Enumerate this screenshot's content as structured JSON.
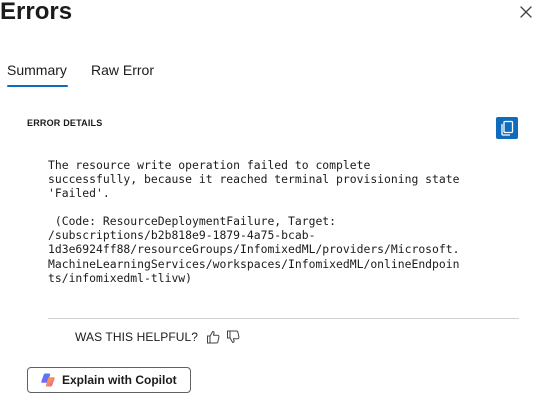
{
  "header": {
    "title": "Errors"
  },
  "tabs": [
    {
      "label": "Summary",
      "selected": true
    },
    {
      "label": "Raw Error",
      "selected": false
    }
  ],
  "details": {
    "section_label": "ERROR DETAILS",
    "message": "The resource write operation failed to complete\nsuccessfully, because it reached terminal provisioning state\n'Failed'.",
    "code_block": " (Code: ResourceDeploymentFailure, Target:\n/subscriptions/b2b818e9-1879-4a75-bcab-\n1d3e6924ff88/resourceGroups/InfomixedML/providers/Microsoft.\nMachineLearningServices/workspaces/InfomixedML/onlineEndpoin\nts/infomixedml-tlivw)"
  },
  "feedback": {
    "label": "WAS THIS HELPFUL?"
  },
  "copilot": {
    "label": "Explain with Copilot"
  },
  "icons": {
    "close": "close-icon",
    "copy": "copy-icon",
    "thumbs_up": "thumbs-up-icon",
    "thumbs_down": "thumbs-down-icon",
    "copilot": "copilot-icon"
  },
  "colors": {
    "accent": "#0f6cbd",
    "text": "#1b1b1b",
    "divider": "#d1d1d1"
  }
}
